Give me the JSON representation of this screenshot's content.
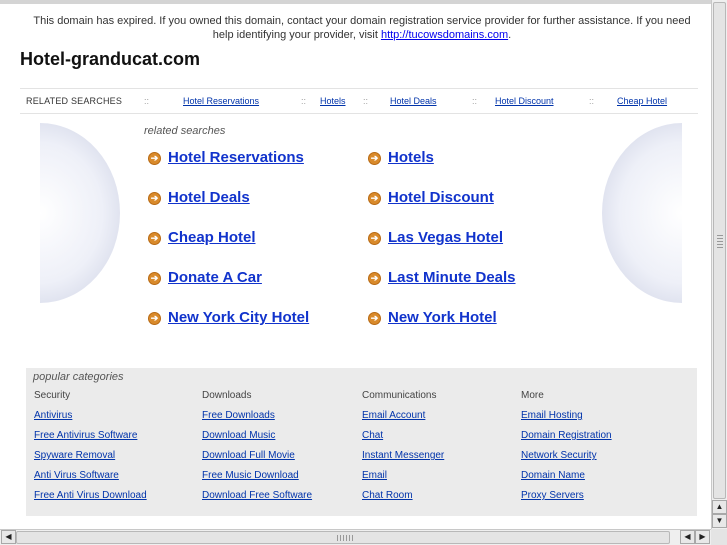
{
  "notice": {
    "text": "This domain has expired. If you owned this domain, contact your domain registration service provider for further assistance. If you need help identifying your provider, visit ",
    "link": "http://tucowsdomains.com",
    "end": "."
  },
  "site_title": "Hotel-granducat.com",
  "related_bar": {
    "label": "RELATED SEARCHES",
    "separator": "::",
    "links": [
      "Hotel Reservations",
      "Hotels",
      "Hotel Deals",
      "Hotel Discount",
      "Cheap Hotel"
    ]
  },
  "related_searches": {
    "caption": "related searches",
    "arrow_glyph": "➔",
    "left": [
      "Hotel Reservations",
      "Hotel Deals",
      "Cheap Hotel",
      "Donate A Car",
      "New York City Hotel"
    ],
    "right": [
      "Hotels",
      "Hotel Discount",
      "Las Vegas Hotel",
      "Last Minute Deals",
      "New York Hotel"
    ]
  },
  "popular": {
    "caption": "popular categories",
    "columns": [
      {
        "heading": "Security",
        "links": [
          "Antivirus",
          "Free Antivirus Software",
          "Spyware Removal",
          "Anti Virus Software",
          "Free Anti Virus Download"
        ]
      },
      {
        "heading": "Downloads",
        "links": [
          "Free Downloads",
          "Download Music",
          "Download Full Movie",
          "Free Music Download",
          "Download Free Software"
        ]
      },
      {
        "heading": "Communications",
        "links": [
          "Email Account",
          "Chat",
          "Instant Messenger",
          "Email",
          "Chat Room"
        ]
      },
      {
        "heading": "More",
        "links": [
          "Email Hosting",
          "Domain Registration",
          "Network Security",
          "Domain Name",
          "Proxy Servers"
        ]
      }
    ]
  },
  "scrollbars": {
    "up": "▲",
    "down": "▼",
    "left": "◀",
    "right": "▶"
  },
  "colors": {
    "link": "#1133cc",
    "arrow": "#d98a2b",
    "panel": "#ebebeb"
  }
}
